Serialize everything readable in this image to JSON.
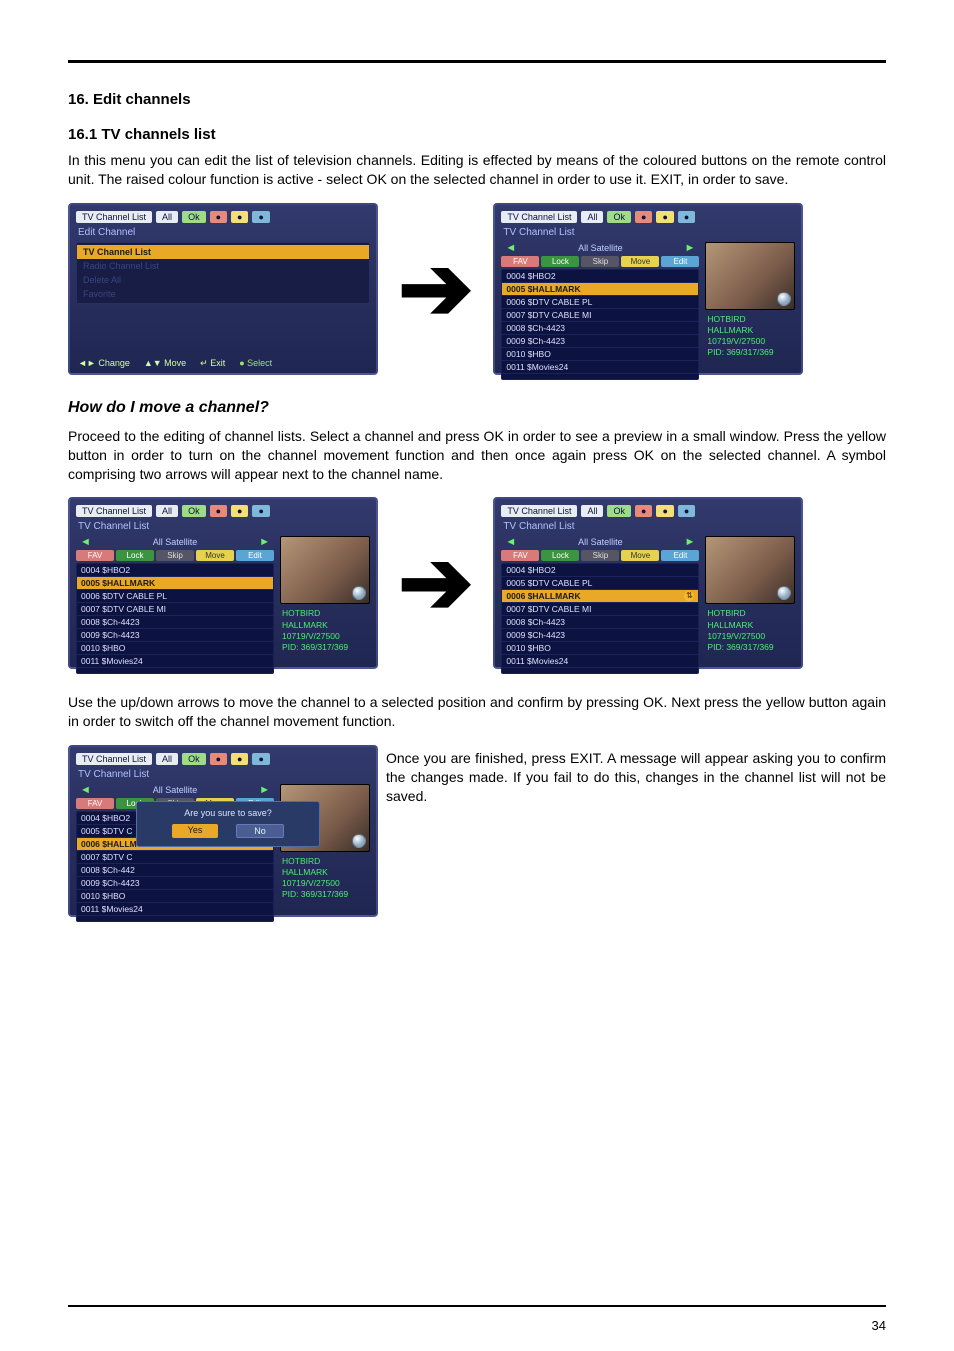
{
  "headings": {
    "h16": "16. Edit channels",
    "h16_1": "16.1 TV channels list",
    "how_move": "How do I move a channel?"
  },
  "paras": {
    "p1": "In this menu you can edit the list of television channels. Editing is effected by means of the coloured buttons on the remote control unit. The raised colour function is active - select OK on the selected channel in order to use it. EXIT, in order to save.",
    "p2": "Proceed to the editing of channel lists. Select a channel and press OK in order to see a preview in a small window. Press the yellow button in order to turn on the channel movement function and then once again press OK on the selected channel. A symbol comprising two arrows will appear next to the channel name.",
    "p3": "Use the up/down arrows to move the channel to a selected position and confirm by pressing OK. Next press the yellow button again in order to switch off the channel movement function.",
    "p4": "Once you are finished, press EXIT. A message will appear asking you to confirm the changes made. If you fail to do this, changes in the channel list will not be saved."
  },
  "arrow": "➔",
  "osd_common": {
    "title_main": "TV Channel List",
    "chips": [
      "All",
      "Ok",
      "●",
      "●",
      "●"
    ],
    "panel_edit": "Edit Channel",
    "panel_list": "TV Channel List",
    "satellite": "All Satellite",
    "tags": {
      "fav": "FAV",
      "lock": "Lock",
      "skip": "Skip",
      "move": "Move",
      "edit": "Edit"
    },
    "info": {
      "sat": "HOTBIRD",
      "name": "HALLMARK",
      "freq": "10719/V/27500",
      "pid": "PID: 369/317/369"
    }
  },
  "menu_items": [
    {
      "label": "TV Channel List",
      "sel": true
    },
    {
      "label": "Radio Channel List",
      "sel": false
    },
    {
      "label": "Delete All",
      "sel": false
    },
    {
      "label": "Favorite",
      "sel": false
    }
  ],
  "footer_hints": {
    "change": "◄► Change",
    "move": "▲▼ Move",
    "exit": "↵ Exit",
    "select": "● Select"
  },
  "channels_a": [
    {
      "label": "0004 $HBO2"
    },
    {
      "label": "0005 $HALLMARK",
      "sel": true
    },
    {
      "label": "0006 $DTV CABLE PL"
    },
    {
      "label": "0007 $DTV CABLE MI"
    },
    {
      "label": "0008 $Ch-4423"
    },
    {
      "label": "0009 $Ch-4423"
    },
    {
      "label": "0010 $HBO"
    },
    {
      "label": "0011 $Movies24"
    }
  ],
  "channels_b": [
    {
      "label": "0004 $HBO2"
    },
    {
      "label": "0005 $HALLMARK",
      "sel": true
    },
    {
      "label": "0006 $DTV CABLE PL"
    },
    {
      "label": "0007 $DTV CABLE MI"
    },
    {
      "label": "0008 $Ch-4423"
    },
    {
      "label": "0009 $Ch-4423"
    },
    {
      "label": "0010 $HBO"
    },
    {
      "label": "0011 $Movies24"
    }
  ],
  "channels_c": [
    {
      "label": "0004 $HBO2"
    },
    {
      "label": "0005 $DTV CABLE PL"
    },
    {
      "label": "0006 $HALLMARK",
      "sel": true,
      "badge": true
    },
    {
      "label": "0007 $DTV CABLE MI"
    },
    {
      "label": "0008 $Ch-4423"
    },
    {
      "label": "0009 $Ch-4423"
    },
    {
      "label": "0010 $HBO"
    },
    {
      "label": "0011 $Movies24"
    }
  ],
  "channels_d": [
    {
      "label": "0004 $HBO2"
    },
    {
      "label": "0005 $DTV C"
    },
    {
      "label": "0006 $HALLM",
      "sel": true
    },
    {
      "label": "0007 $DTV C"
    },
    {
      "label": "0008 $Ch-442"
    },
    {
      "label": "0009 $Ch-4423"
    },
    {
      "label": "0010 $HBO"
    },
    {
      "label": "0011 $Movies24"
    }
  ],
  "dialog": {
    "msg": "Are you sure to save?",
    "yes": "Yes",
    "no": "No"
  },
  "page_number": "34"
}
